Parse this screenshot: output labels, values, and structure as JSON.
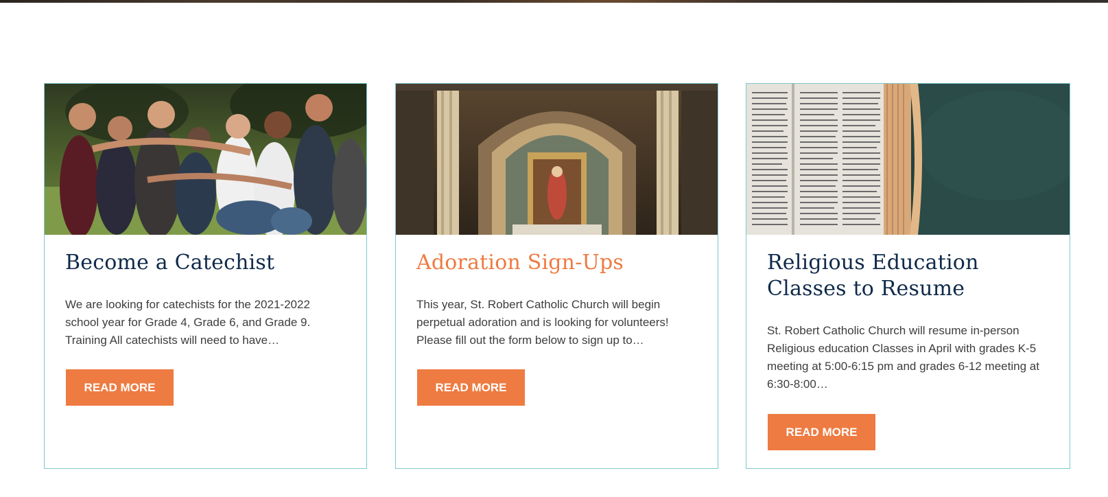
{
  "cards": [
    {
      "title": "Become a Catechist",
      "excerpt": "We are looking for catechists for the 2021-2022 school year for Grade 4, Grade 6, and Grade 9. Training All catechists will need to have…",
      "button_label": "READ MORE"
    },
    {
      "title": "Adoration Sign-Ups",
      "excerpt": "This year, St. Robert Catholic Church will begin perpetual adoration and is looking for volunteers! Please fill out the form below to sign up to…",
      "button_label": "READ MORE"
    },
    {
      "title": "Religious Education Classes to Resume",
      "excerpt": "St. Robert Catholic Church will resume in-person Religious education Classes in April with grades K-5 meeting at 5:00-6:15 pm and grades 6-12 meeting at 6:30-8:00…",
      "button_label": "READ MORE"
    }
  ],
  "colors": {
    "title": "#0f2a4a",
    "title_accent": "#ee7b42",
    "button": "#ee7b42",
    "card_border": "#7cc8d0",
    "body_text": "#3d3d3d"
  },
  "images": [
    "group-hug-photo",
    "church-altar-photo",
    "open-bible-photo"
  ]
}
